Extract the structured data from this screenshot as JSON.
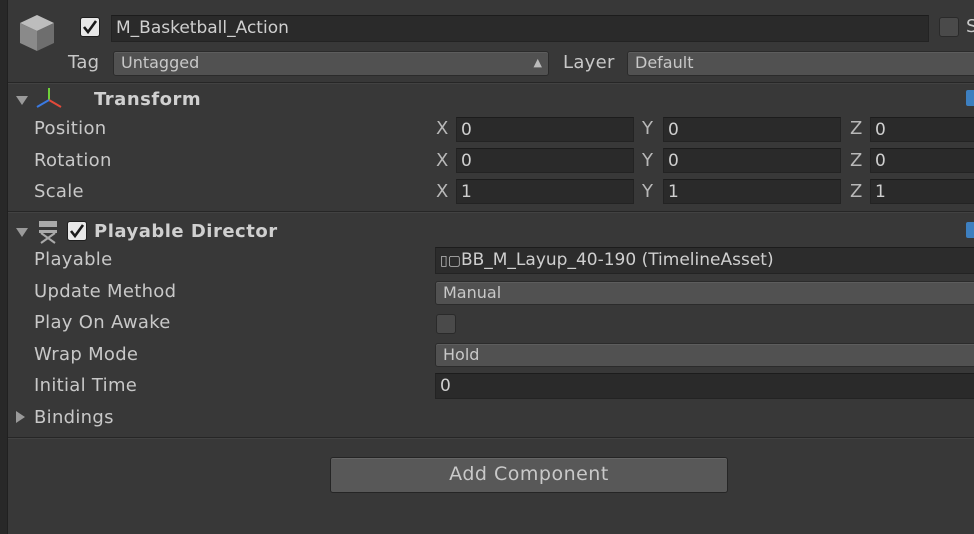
{
  "header": {
    "object_name": "M_Basketball_Action",
    "active": true,
    "static_label": "S",
    "tag_label": "Tag",
    "tag_value": "Untagged",
    "layer_label": "Layer",
    "layer_value": "Default"
  },
  "transform": {
    "title": "Transform",
    "rows": [
      {
        "label": "Position",
        "x": "0",
        "y": "0",
        "z": "0"
      },
      {
        "label": "Rotation",
        "x": "0",
        "y": "0",
        "z": "0"
      },
      {
        "label": "Scale",
        "x": "1",
        "y": "1",
        "z": "1"
      }
    ],
    "axis_labels": [
      "X",
      "Y",
      "Z"
    ]
  },
  "playable_director": {
    "title": "Playable Director",
    "enabled": true,
    "fields": {
      "playable_label": "Playable",
      "playable_value": "BB_M_Layup_40-190 (TimelineAsset)",
      "update_method_label": "Update Method",
      "update_method_value": "Manual",
      "play_on_awake_label": "Play On Awake",
      "play_on_awake_value": false,
      "wrap_mode_label": "Wrap Mode",
      "wrap_mode_value": "Hold",
      "initial_time_label": "Initial Time",
      "initial_time_value": "0"
    },
    "bindings_label": "Bindings"
  },
  "footer": {
    "add_component_label": "Add Component"
  },
  "colors": {
    "panel_bg": "#383838",
    "field_bg": "#2a2a2a",
    "accent_blue": "#3d7fc0"
  }
}
